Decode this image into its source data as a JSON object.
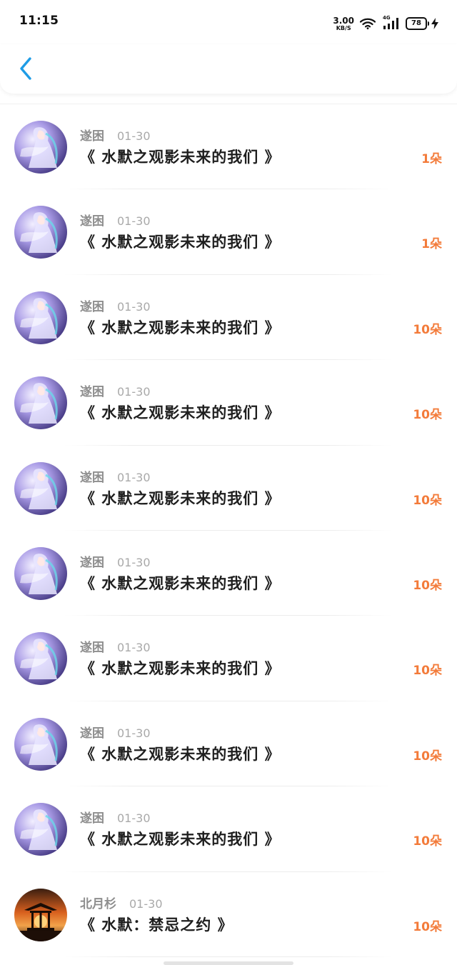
{
  "status_bar": {
    "time": "11:15",
    "net_speed_value": "3.00",
    "net_speed_unit": "KB/S",
    "network_type": "4G",
    "battery_level": "78",
    "icons": [
      "wifi-icon",
      "signal-icon",
      "battery-icon",
      "charging-bolt-icon"
    ]
  },
  "header": {
    "back_icon": "chevron-left-icon",
    "accent_color": "#1e9ce6"
  },
  "colors": {
    "gift_count": "#f37b3a",
    "user_name": "#8e8e8e",
    "date": "#a9a9a9",
    "title": "#1f1f1f"
  },
  "items": [
    {
      "user": "遂困",
      "date": "01-30",
      "title": "《 水默之观影未来的我们 》",
      "count": "1朵",
      "avatar": "anime-girl-avatar"
    },
    {
      "user": "遂困",
      "date": "01-30",
      "title": "《 水默之观影未来的我们 》",
      "count": "1朵",
      "avatar": "anime-girl-avatar"
    },
    {
      "user": "遂困",
      "date": "01-30",
      "title": "《 水默之观影未来的我们 》",
      "count": "10朵",
      "avatar": "anime-girl-avatar"
    },
    {
      "user": "遂困",
      "date": "01-30",
      "title": "《 水默之观影未来的我们 》",
      "count": "10朵",
      "avatar": "anime-girl-avatar"
    },
    {
      "user": "遂困",
      "date": "01-30",
      "title": "《 水默之观影未来的我们 》",
      "count": "10朵",
      "avatar": "anime-girl-avatar"
    },
    {
      "user": "遂困",
      "date": "01-30",
      "title": "《 水默之观影未来的我们 》",
      "count": "10朵",
      "avatar": "anime-girl-avatar"
    },
    {
      "user": "遂困",
      "date": "01-30",
      "title": "《 水默之观影未来的我们 》",
      "count": "10朵",
      "avatar": "anime-girl-avatar"
    },
    {
      "user": "遂困",
      "date": "01-30",
      "title": "《 水默之观影未来的我们 》",
      "count": "10朵",
      "avatar": "anime-girl-avatar"
    },
    {
      "user": "遂困",
      "date": "01-30",
      "title": "《 水默之观影未来的我们 》",
      "count": "10朵",
      "avatar": "anime-girl-avatar"
    },
    {
      "user": "北月杉",
      "date": "01-30",
      "title": "《 水默：禁忌之约 》",
      "count": "10朵",
      "avatar": "sunset-pavilion-avatar"
    }
  ]
}
